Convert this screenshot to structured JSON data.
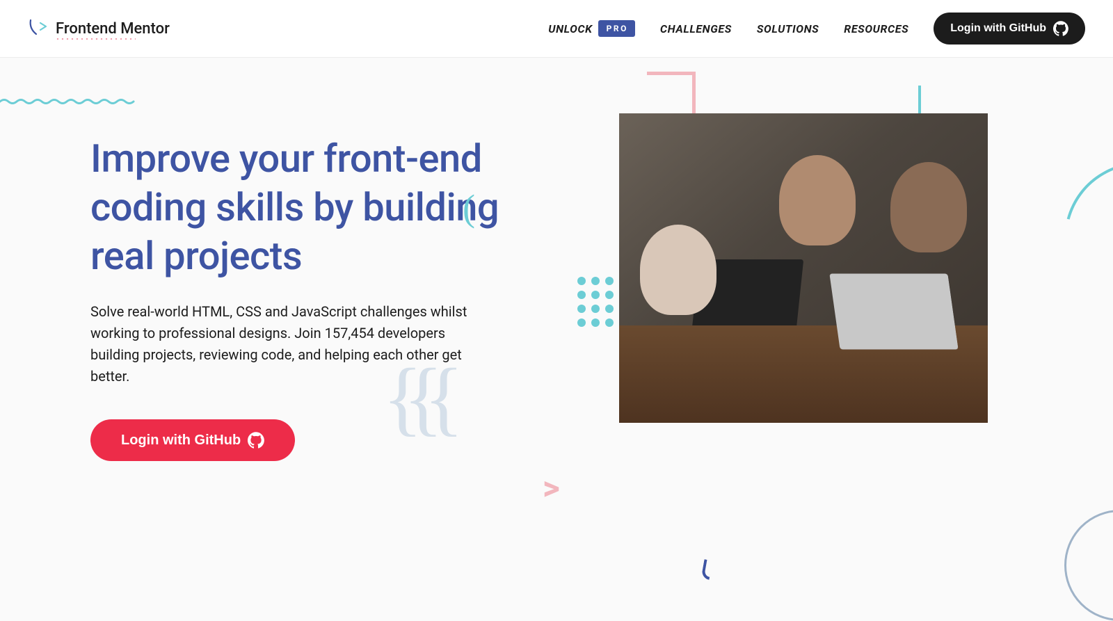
{
  "brand": {
    "name": "Frontend Mentor"
  },
  "nav": {
    "unlock": "UNLOCK",
    "pro_badge": "PRO",
    "items": [
      "CHALLENGES",
      "SOLUTIONS",
      "RESOURCES"
    ],
    "login_label": "Login with GitHub"
  },
  "hero": {
    "headline": "Improve your front-end coding skills by building real projects",
    "subtext": "Solve real-world HTML, CSS and JavaScript challenges whilst working to professional designs. Join 157,454 developers building projects, reviewing code, and helping each other get better.",
    "cta_label": "Login with GitHub"
  },
  "colors": {
    "primary_blue": "#3e54a3",
    "accent_red": "#ed2c49",
    "accent_teal": "#6ccdd5",
    "accent_pink": "#f2b6bd"
  }
}
